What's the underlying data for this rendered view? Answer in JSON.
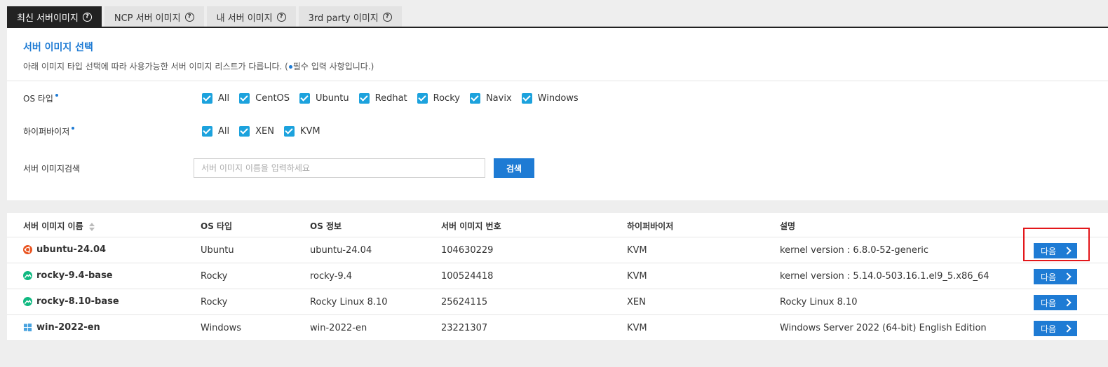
{
  "tabs": [
    {
      "label": "최신 서버이미지",
      "active": true
    },
    {
      "label": "NCP 서버 이미지",
      "active": false
    },
    {
      "label": "내 서버 이미지",
      "active": false
    },
    {
      "label": "3rd party 이미지",
      "active": false
    }
  ],
  "panel": {
    "title": "서버 이미지 선택",
    "desc_before": "아래 이미지 타입 선택에 따라 사용가능한 서버 이미지 리스트가 다릅니다. (",
    "desc_after": "필수 입력 사항입니다.)"
  },
  "filters": {
    "os_type": {
      "label": "OS 타입",
      "options": [
        "All",
        "CentOS",
        "Ubuntu",
        "Redhat",
        "Rocky",
        "Navix",
        "Windows"
      ]
    },
    "hypervisor": {
      "label": "하이퍼바이저",
      "options": [
        "All",
        "XEN",
        "KVM"
      ]
    },
    "search": {
      "label": "서버 이미지검색",
      "placeholder": "서버 이미지 이름을 입력하세요",
      "value": "",
      "button": "검색"
    }
  },
  "table": {
    "headers": [
      "서버 이미지 이름",
      "OS 타입",
      "OS 정보",
      "서버 이미지 번호",
      "하이퍼바이저",
      "설명"
    ],
    "rows": [
      {
        "name": "ubuntu-24.04",
        "icon": "ubuntu-icon",
        "os_type": "Ubuntu",
        "os_info": "ubuntu-24.04",
        "number": "104630229",
        "hypervisor": "KVM",
        "desc": "kernel version : 6.8.0-52-generic",
        "action": "다음"
      },
      {
        "name": "rocky-9.4-base",
        "icon": "rocky-icon",
        "os_type": "Rocky",
        "os_info": "rocky-9.4",
        "number": "100524418",
        "hypervisor": "KVM",
        "desc": "kernel version : 5.14.0-503.16.1.el9_5.x86_64",
        "action": "다음"
      },
      {
        "name": "rocky-8.10-base",
        "icon": "rocky-icon",
        "os_type": "Rocky",
        "os_info": "Rocky Linux 8.10",
        "number": "25624115",
        "hypervisor": "XEN",
        "desc": "Rocky Linux 8.10",
        "action": "다음"
      },
      {
        "name": "win-2022-en",
        "icon": "windows-icon",
        "os_type": "Windows",
        "os_info": "win-2022-en",
        "number": "23221307",
        "hypervisor": "KVM",
        "desc": "Windows Server 2022 (64-bit) English Edition",
        "action": "다음"
      }
    ]
  },
  "colors": {
    "accent": "#1e7bd4",
    "checkbox": "#1ca2dd",
    "highlight": "#e3171b"
  }
}
